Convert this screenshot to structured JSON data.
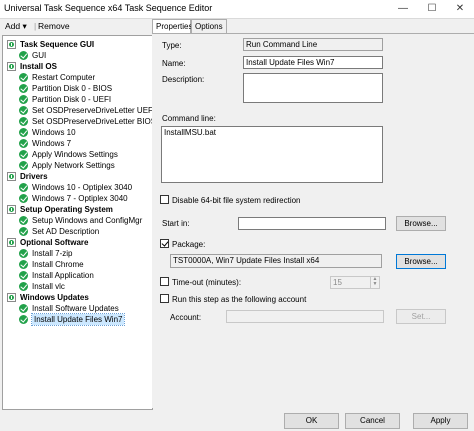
{
  "window": {
    "title": "Universal Task Sequence x64 Task Sequence Editor",
    "minimize": "—",
    "maximize": "☐",
    "close": "✕"
  },
  "menu": {
    "add": "Add",
    "add_arrow": "▾",
    "sep": "|",
    "remove": "Remove"
  },
  "tree": [
    {
      "label": "Task Sequence GUI",
      "kind": "group"
    },
    {
      "label": "GUI",
      "kind": "step"
    },
    {
      "label": "Install OS",
      "kind": "group"
    },
    {
      "label": "Restart Computer",
      "kind": "step"
    },
    {
      "label": "Partition Disk 0 - BIOS",
      "kind": "step"
    },
    {
      "label": "Partition Disk 0 - UEFI",
      "kind": "step"
    },
    {
      "label": "Set OSDPreserveDriveLetter UEFI",
      "kind": "step"
    },
    {
      "label": "Set OSDPreserveDriveLetter BIOS",
      "kind": "step"
    },
    {
      "label": "Windows 10",
      "kind": "step"
    },
    {
      "label": "Windows 7",
      "kind": "step"
    },
    {
      "label": "Apply Windows Settings",
      "kind": "step"
    },
    {
      "label": "Apply Network Settings",
      "kind": "step"
    },
    {
      "label": "Drivers",
      "kind": "group"
    },
    {
      "label": "Windows 10 - Optiplex 3040",
      "kind": "step"
    },
    {
      "label": "Windows 7 - Optiplex 3040",
      "kind": "step"
    },
    {
      "label": "Setup Operating System",
      "kind": "group"
    },
    {
      "label": "Setup Windows and ConfigMgr",
      "kind": "step"
    },
    {
      "label": "Set AD Description",
      "kind": "step"
    },
    {
      "label": "Optional Software",
      "kind": "group"
    },
    {
      "label": "Install 7-zip",
      "kind": "step"
    },
    {
      "label": "Install Chrome",
      "kind": "step"
    },
    {
      "label": "Install Application",
      "kind": "step"
    },
    {
      "label": "Install vlc",
      "kind": "step"
    },
    {
      "label": "Windows Updates",
      "kind": "group"
    },
    {
      "label": "Install Software Updates",
      "kind": "step"
    },
    {
      "label": "Install Update Files Win7",
      "kind": "step",
      "selected": true
    }
  ],
  "tabs": {
    "properties": "Properties",
    "options": "Options"
  },
  "props": {
    "type_label": "Type:",
    "type_value": "Run Command Line",
    "name_label": "Name:",
    "name_value": "Install Update Files Win7",
    "desc_label": "Description:",
    "desc_value": "",
    "cmd_label": "Command line:",
    "cmd_value": "InstallMSU.bat",
    "disable64_label": "Disable 64-bit file system redirection",
    "disable64_checked": false,
    "startin_label": "Start in:",
    "startin_value": "",
    "browse": "Browse...",
    "package_label": "Package:",
    "package_checked": true,
    "package_value": "TST0000A, Win7 Update Files Install x64",
    "browse2": "Browse...",
    "timeout_label": "Time-out (minutes):",
    "timeout_checked": false,
    "timeout_value": "15",
    "spin_up": "▲",
    "spin_down": "▼",
    "runas_label": "Run this step as the following account",
    "runas_checked": false,
    "account_label": "Account:",
    "account_value": "",
    "set": "Set..."
  },
  "buttons": {
    "ok": "OK",
    "cancel": "Cancel",
    "apply": "Apply"
  }
}
